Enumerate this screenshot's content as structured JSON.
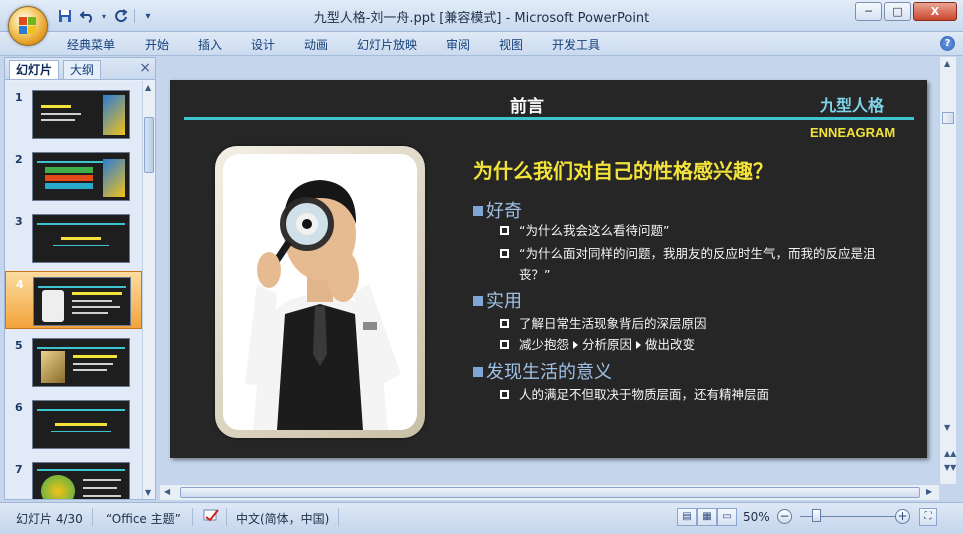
{
  "window": {
    "title": "九型人格-刘一舟.ppt [兼容模式] - Microsoft PowerPoint",
    "min_label": "─",
    "max_label": "□",
    "close_label": "X"
  },
  "quick_access": {
    "save_icon": "save-icon",
    "undo_icon": "undo-icon",
    "redo_icon": "redo-icon",
    "customize_icon": "chevron-down-icon"
  },
  "ribbon": {
    "tabs": [
      "经典菜单",
      "开始",
      "插入",
      "设计",
      "动画",
      "幻灯片放映",
      "审阅",
      "视图",
      "开发工具"
    ],
    "help_label": "?"
  },
  "left_panel": {
    "tab_slides": "幻灯片",
    "tab_outline": "大纲",
    "close_label": "×",
    "thumbnails": [
      {
        "num": "1",
        "selected": false
      },
      {
        "num": "2",
        "selected": false
      },
      {
        "num": "3",
        "selected": false
      },
      {
        "num": "4",
        "selected": true
      },
      {
        "num": "5",
        "selected": false
      },
      {
        "num": "6",
        "selected": false
      },
      {
        "num": "7",
        "selected": false
      }
    ]
  },
  "slide": {
    "title": "前言",
    "brand": "九型人格",
    "subtitle": "ENNEAGRAM",
    "question": "为什么我们对自己的性格感兴趣？",
    "sections": [
      {
        "heading": "好奇",
        "items": [
          "“为什么我会这么看待问题”",
          "“为什么面对同样的问题，我朋友的反应时生气，而我的反应是沮丧？”"
        ]
      },
      {
        "heading": "实用",
        "items": [
          "了解日常生活现象背后的深层原因",
          "减少抱怨",
          "分析原因",
          "做出改变"
        ]
      },
      {
        "heading": "发现生活的意义",
        "items": [
          "人的满足不但取决于物质层面，还有精神层面"
        ]
      }
    ]
  },
  "status": {
    "slide_pos": "幻灯片 4/30",
    "theme": "“Office 主题”",
    "language": "中文(简体，中国)",
    "zoom": "50%",
    "zoom_out": "−",
    "zoom_in": "+"
  },
  "colors": {
    "slide_bg": "#262626",
    "accent_cyan": "#3ec3d0",
    "accent_yellow": "#f2e23a",
    "heading_blue": "#9fc0e6",
    "selected_thumb": "#f3a33b"
  }
}
